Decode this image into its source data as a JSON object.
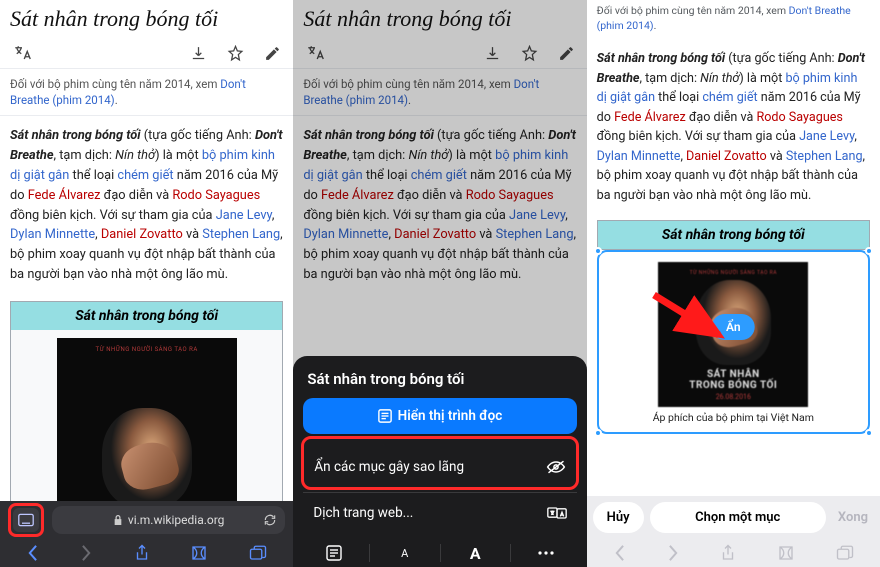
{
  "article": {
    "title_serif": "Sát nhân trong bóng tối",
    "hatnote_prefix": "Đối với bộ phim cùng tên năm 2014, xem ",
    "hatnote_link": "Don't Breathe (phim 2014)",
    "body_html": "<b><i>Sát nhân trong bóng tối</i></b> (tựa gốc tiếng Anh: <b><i>Don't Breathe</i></b>, tạm dịch: <i>Nín thở</i>) là một <a class='blue'>bộ phim kinh dị giật gân</a> thể loại <a class='blue'>chém giết</a> năm 2016 của Mỹ do <a class='red'>Fede Álvarez</a> đạo diễn và <a class='red'>Rodo Sayagues</a> đồng biên kịch. Với sự tham gia của <a class='blue'>Jane Levy</a>, <a class='blue'>Dylan Minnette</a>, <a class='red'>Daniel Zovatto</a> và <a class='blue'>Stephen Lang</a>, bộ phim xoay quanh vụ đột nhập bất thành của ba người bạn vào nhà một ông lão mù.",
    "infobox_header": "Sát nhân trong bóng tối",
    "poster_top": "TỪ NHỮNG NGƯỜI SÁNG TẠO RA",
    "poster_title_line1": "SÁT NHÂN",
    "poster_title_line2": "TRONG BÓNG TỐI",
    "poster_date": "26.08.2016",
    "caption": "Áp phích của bộ phim tại Việt Nam"
  },
  "safari": {
    "url": "vi.m.wikipedia.org"
  },
  "sheet": {
    "title": "Sát nhân trong bóng tối",
    "reader": "Hiển thị trình đọc",
    "hide_distractions": "Ẩn các mục gây sao lãng",
    "translate": "Dịch trang web..."
  },
  "panel3": {
    "hide_button": "Ẩn",
    "cancel": "Hủy",
    "choose": "Chọn một mục",
    "done": "Xong"
  }
}
